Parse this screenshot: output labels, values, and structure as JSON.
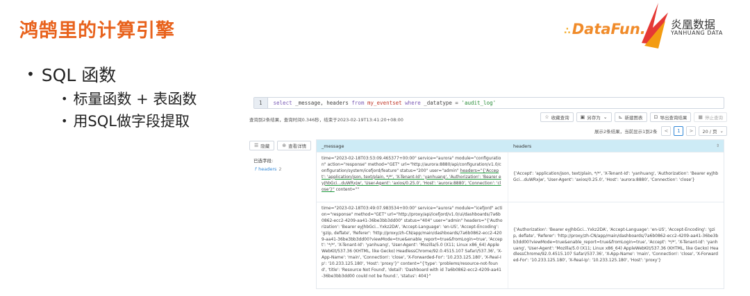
{
  "slide": {
    "title": "鸿鹄里的计算引擎",
    "brand_datafun": "DataFun.",
    "brand_yh": "炎凰数据",
    "brand_yh_en": "YANHUANG DATA",
    "bullets": {
      "main": "SQL 函数",
      "sub1": "标量函数 + 表函数",
      "sub2": "用SQL做字段提取"
    }
  },
  "query": {
    "line_no": "1",
    "parts": {
      "select": "select",
      "cols": " _message, headers ",
      "from": "from",
      "table": " my_eventset ",
      "where": "where",
      "cond": " _datatype = ",
      "value": "'audit_log'"
    }
  },
  "info": "查询到2条结果，查询时间0.346秒，结束于2023-02-19T13:41:20+08:00",
  "toolbar": {
    "fav": "收藏查询",
    "save_as": "另存为",
    "new_chart": "新建图表",
    "export": "导出查询结果",
    "stop": "停止查询"
  },
  "pager": {
    "text": "展示2条结果，当前显示1到2条",
    "prev": "<",
    "page": "1",
    "next": ">",
    "size": "20 / 页"
  },
  "side": {
    "hide": "隐藏",
    "detail": "查看详情",
    "selected_title": "已选字段:",
    "field_name": "headers",
    "field_count": "2",
    "field_type": "f"
  },
  "table": {
    "columns": [
      "_message",
      "headers"
    ],
    "rows": [
      {
        "message_pre": "time=\"2023-02-18T03:53:09.465377+00:00\" service=\"aurora\" module=\"configuration\" action=\"response\" method=\"GET\" url=\"http://aurora:8880/api/configuration/v1.0/configuration/system/icefjord/feature\" status=\"200\" user=\"admin\" ",
        "message_hl": "headers=\"{'Accept': 'application/json, text/plain, */*', 'X-Tenant-Id': 'yanhuang', 'Authorization': 'Bearer eyJhbGci...duWRxjw', 'User-Agent': 'axios/0.25.0', 'Host': 'aurora:8880', 'Connection': 'close'}\"",
        "message_post": " content=\"\"",
        "headers": "{'Accept': 'application/json, text/plain, */*', 'X-Tenant-Id': 'yanhuang', 'Authorization': 'Bearer eyJhbGci...duWRxjw', 'User-Agent': 'axios/0.25.0', 'Host': 'aurora:8880', 'Connection': 'close'}"
      },
      {
        "message": "time=\"2023-02-18T03:49:07.983534+00:00\" service=\"aurora\" module=\"icefjord\" action=\"response\" method=\"GET\" url=\"http://proxy/api/icefjord/v1.0/ui/dashboards/7a6b0862-ecc2-4209-aa41-36be3bb3dd00\" status=\"404\" user=\"admin\" headers=\"{'Authorization': 'Bearer eyJhbGci...Yxkz2DA', 'Accept-Language': 'en-US', 'Accept-Encoding': 'gzip, deflate', 'Referer': 'http://proxy/zh-CN/app/main/dashboards/7a6b0862-ecc2-4209-aa41-36be3bb3dd00?viewMode=true&enable_report=true&fromLogin=true', 'Accept': '*/*', 'X-Tenant-Id': 'yanhuang', 'User-Agent': 'Mozilla/5.0 (X11; Linux x86_64) AppleWebKit/537.36 (KHTML, like Gecko) HeadlessChrome/92.0.4515.107 Safari/537.36', 'X-App-Name': 'main', 'Connection': 'close', 'X-Forwarded-For': '10.233.125.180', 'X-Real-Ip': '10.233.125.180', 'Host': 'proxy'}\" content=\"{'type': 'problems/resource-not-found', 'title': 'Resource Not Found', 'detail': 'Dashboard with id 7a6b0862-ecc2-4209-aa41-36be3bb3dd00 could not be found.', 'status': 404}\"",
        "headers": "{'Authorization': 'Bearer eyJhbGci...Yxkz2DA', 'Accept-Language': 'en-US', 'Accept-Encoding': 'gzip, deflate', 'Referer': 'http://proxy/zh-CN/app/main/dashboards/7a6b0862-ecc2-4209-aa41-36be3bb3dd00?viewMode=true&enable_report=true&fromLogin=true', 'Accept': '*/*', 'X-Tenant-Id': 'yanhuang', 'User-Agent': 'Mozilla/5.0 (X11; Linux x86_64) AppleWebKit/537.36 (KHTML, like Gecko) HeadlessChrome/92.0.4515.107 Safari/537.36', 'X-App-Name': 'main', 'Connection': 'close', 'X-Forwarded-For': '10.233.125.180', 'X-Real-Ip': '10.233.125.180', 'Host': 'proxy'}"
      }
    ]
  },
  "colors": {
    "title_orange": "#e8621c",
    "header_blue": "#cdebf6",
    "link_blue": "#2f86d6",
    "underline_green": "#1a9a3a"
  }
}
